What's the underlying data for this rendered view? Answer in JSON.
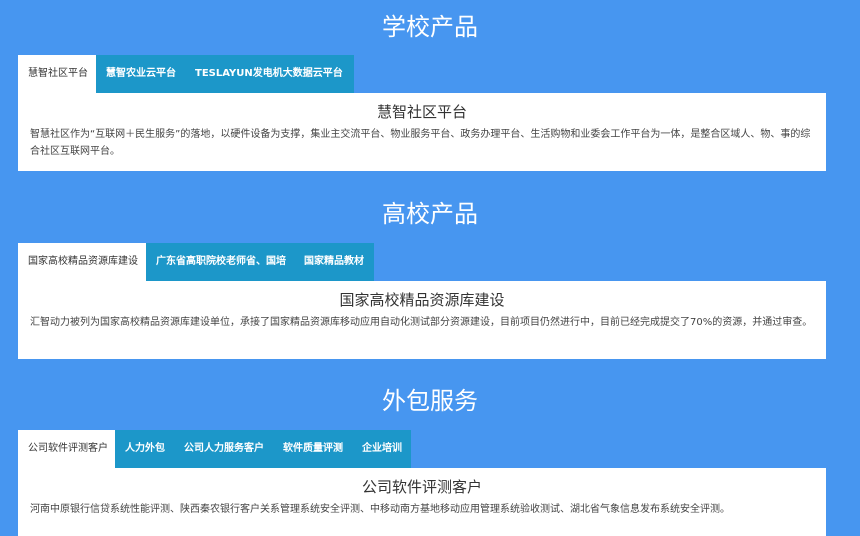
{
  "sections": [
    {
      "title": "学校产品",
      "tabs": [
        "慧智社区平台",
        "慧智农业云平台",
        "TESLAYUN发电机大数据云平台"
      ],
      "active_tab": 0,
      "panel": {
        "heading": "慧智社区平台",
        "text": "智慧社区作为“互联网＋民生服务”的落地，以硬件设备为支撑，集业主交流平台、物业服务平台、政务办理平台、生活购物和业委会工作平台为一体，是整合区域人、物、事的综合社区互联网平台。"
      }
    },
    {
      "title": "高校产品",
      "tabs": [
        "国家高校精品资源库建设",
        "广东省高职院校老师省、国培",
        "国家精品教材"
      ],
      "active_tab": 0,
      "panel": {
        "heading": "国家高校精品资源库建设",
        "text": "汇智动力被列为国家高校精品资源库建设单位，承接了国家精品资源库移动应用自动化测试部分资源建设，目前项目仍然进行中，目前已经完成提交了70%的资源，并通过审查。"
      }
    },
    {
      "title": "外包服务",
      "tabs": [
        "公司软件评测客户",
        "人力外包",
        "公司人力服务客户",
        "软件质量评测",
        "企业培训"
      ],
      "active_tab": 0,
      "panel": {
        "heading": "公司软件评测客户",
        "text": "河南中原银行信贷系统性能评测、陕西秦农银行客户关系管理系统安全评测、中移动南方基地移动应用管理系统验收测试、湖北省气象信息发布系统安全评测。"
      }
    }
  ],
  "colors": {
    "background": "#4796f0",
    "tab_inactive": "#1c97c9",
    "tab_active": "#ffffff",
    "panel": "#ffffff"
  }
}
